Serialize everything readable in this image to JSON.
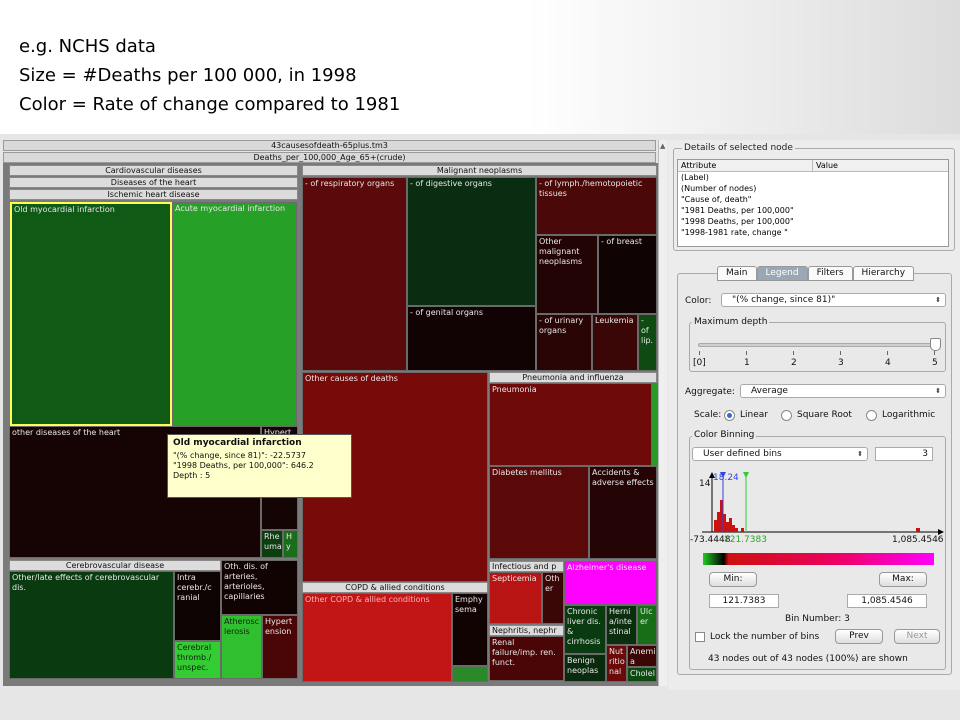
{
  "caption": {
    "line1": "e.g. NCHS data",
    "line2": "Size = #Deaths per 100 000, in 1998",
    "line3": "Color = Rate of change compared to 1981"
  },
  "treemap": {
    "title": "43causesofdeath-65plus.tm3",
    "subtitle": "Deaths_per_100,000_Age_65+(crude)",
    "headers": {
      "cardio": "Cardiovascular diseases",
      "diseases_heart": "Diseases of the heart",
      "ischemic": "Ischemic heart disease",
      "malignant": "Malignant neoplasms",
      "pneumonia_group": "Pneumonia and influenza",
      "cerebro": "Cerebrovascular disease",
      "oth_dis": "Oth. dis. of arteries, arterioles, capillaries",
      "copd": "COPD & allied conditions",
      "infectious": "Infectious and p",
      "nephritis": "Nephritis, nephr"
    },
    "cells": {
      "old_mi": "Old myocardial infarction",
      "acute_mi": "Acute myocardial infarction",
      "other_heart": "other diseases of the heart",
      "hypert": "Hypert",
      "rheuma": "Rhe uma",
      "hy": "H y",
      "respiratory": "- of respiratory organs",
      "digestive": "- of digestive organs",
      "lymph": "- of lymph./hemotopoietic tissues",
      "other_malignant": "Other malignant neoplasms",
      "breast": "- of breast",
      "genital": "- of genital organs",
      "urinary": "- of urinary organs",
      "leukemia": "Leukemia",
      "lip": "- of lip.",
      "other_causes": "Other causes of deaths",
      "pneumonia": "Pneumonia",
      "diabetes": "Diabetes mellitus",
      "accidents": "Accidents & adverse effects",
      "other_late": "Other/late effects of cerebrovascular dis.",
      "intra": "Intra cerebr./c ranial",
      "cerebral_thromb": "Cerebral thromb./ unspec.",
      "atheros": "Atherosc lerosis",
      "hypertension": "Hypert ension",
      "other_copd": "Other COPD & allied conditions",
      "emphysema": "Emphy sema",
      "septicemia": "Septicemia",
      "other_inf": "Oth er",
      "alzheimer": "Alzheimer's disease",
      "renal": "Renal failure/imp. ren. funct.",
      "chronic_liver": "Chronic liver dis. & cirrhosis",
      "hernia": "Herni a/inte stinal",
      "ulcer": "Ulc er",
      "benign": "Benign neoplas",
      "nutrition": "Nut ritio nal",
      "anemia": "Anemi a",
      "cholel": "Cholel"
    },
    "tooltip": {
      "title": "Old myocardial infarction",
      "line1": "\"(% change, since 81)\": -22.5737",
      "line2": "\"1998 Deaths, per 100,000\": 646.2",
      "line3": "Depth : 5"
    }
  },
  "panel": {
    "details_title": "Details of selected node",
    "attr_col": "Attribute",
    "value_col": "Value",
    "attributes": [
      "(Label)",
      "(Number of nodes)",
      "\"Cause of, death\"",
      "\"1981 Deaths, per 100,000\"",
      "\"1998 Deaths, per 100,000\"",
      "\"1998-1981 rate, change \""
    ],
    "tabs": [
      "Main",
      "Legend",
      "Filters",
      "Hierarchy"
    ],
    "color_label": "Color:",
    "color_value": "\"(% change, since 81)\"",
    "max_depth_label": "Maximum depth",
    "depth_ticks": [
      "[0]",
      "1",
      "2",
      "3",
      "4",
      "5"
    ],
    "aggregate_label": "Aggregate:",
    "aggregate_value": "Average",
    "scale_label": "Scale:",
    "scale_options": [
      "Linear",
      "Square Root",
      "Logarithmic"
    ],
    "color_binning_label": "Color Binning",
    "binning_value": "User defined bins",
    "bins_count": "3",
    "hist_top": "14",
    "hist_marker1": "18.24",
    "hist_min": "-73.4448",
    "hist_marker2": "121.7383",
    "hist_max": "1,085.4546",
    "min_button": "Min:",
    "max_button": "Max:",
    "min_value": "121.7383",
    "max_value": "1,085.4546",
    "bin_number": "Bin Number: 3",
    "lock_label": "Lock the number of bins",
    "prev_button": "Prev",
    "next_button": "Next",
    "status": "43  nodes out of  43 nodes  (100%) are shown"
  },
  "colors": {
    "green_bright": "#22aa22",
    "green_dark": "#0c3a12",
    "red_bright": "#c01818",
    "red_dark": "#3c0808",
    "magenta": "#ff00ff"
  }
}
